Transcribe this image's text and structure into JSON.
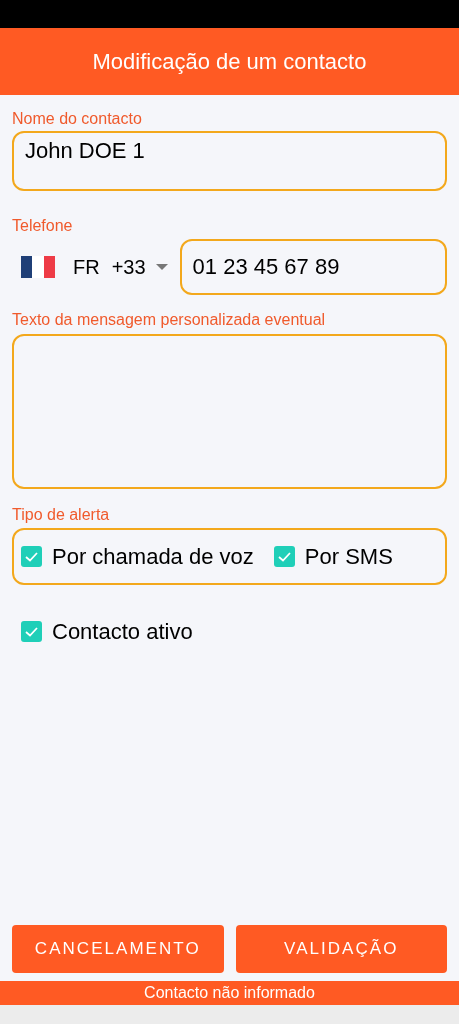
{
  "header": {
    "title": "Modificação de um contacto"
  },
  "name_field": {
    "label": "Nome do contacto",
    "value": "John DOE 1"
  },
  "phone": {
    "label": "Telefone",
    "country_code": "FR",
    "dial_code": "+33",
    "value": "01 23 45 67 89"
  },
  "message_field": {
    "label": "Texto da mensagem personalizada eventual"
  },
  "alert_type": {
    "label": "Tipo de alerta",
    "options": [
      {
        "label": "Por chamada de voz",
        "checked": true
      },
      {
        "label": "Por SMS",
        "checked": true
      }
    ]
  },
  "active": {
    "label": "Contacto ativo",
    "checked": true
  },
  "buttons": [
    "CANCELAMENTO",
    "VALIDAÇÃO"
  ],
  "status_bar": "Contacto não informado"
}
